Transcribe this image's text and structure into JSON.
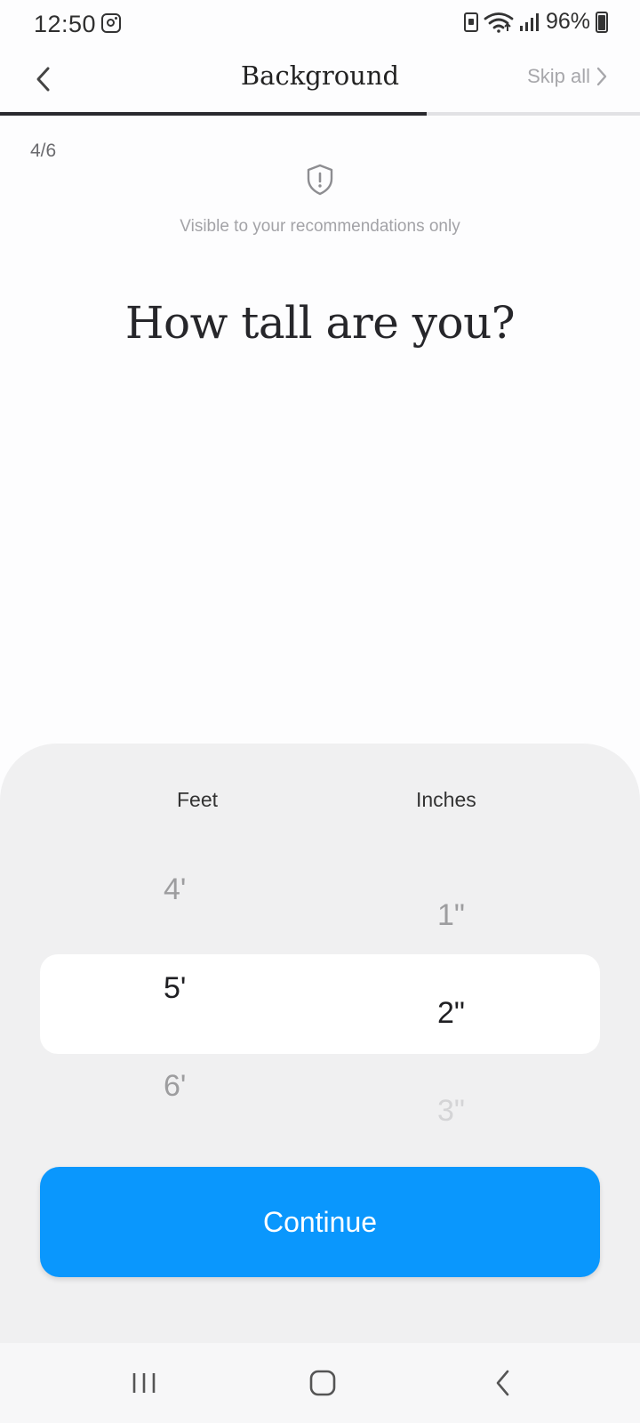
{
  "status_bar": {
    "time": "12:50",
    "battery_percent": "96%",
    "icons": [
      "instagram-icon",
      "battery-saver-icon",
      "wifi-icon",
      "signal-icon",
      "battery-charging-icon"
    ]
  },
  "header": {
    "title": "Background",
    "skip_label": "Skip all",
    "progress_fraction": 0.667
  },
  "step": "4/6",
  "visibility_note": "Visible to your recommendations only",
  "question": "How tall are you?",
  "picker": {
    "feet_label": "Feet",
    "inches_label": "Inches",
    "feet_options": [
      "4'",
      "5'",
      "6'"
    ],
    "inches_options": [
      "1\"",
      "2\"",
      "3\""
    ],
    "selected_feet": "5'",
    "selected_inches": "2\""
  },
  "continue_label": "Continue",
  "colors": {
    "accent": "#0a97fd",
    "sheet_bg": "#f0f0f1"
  }
}
